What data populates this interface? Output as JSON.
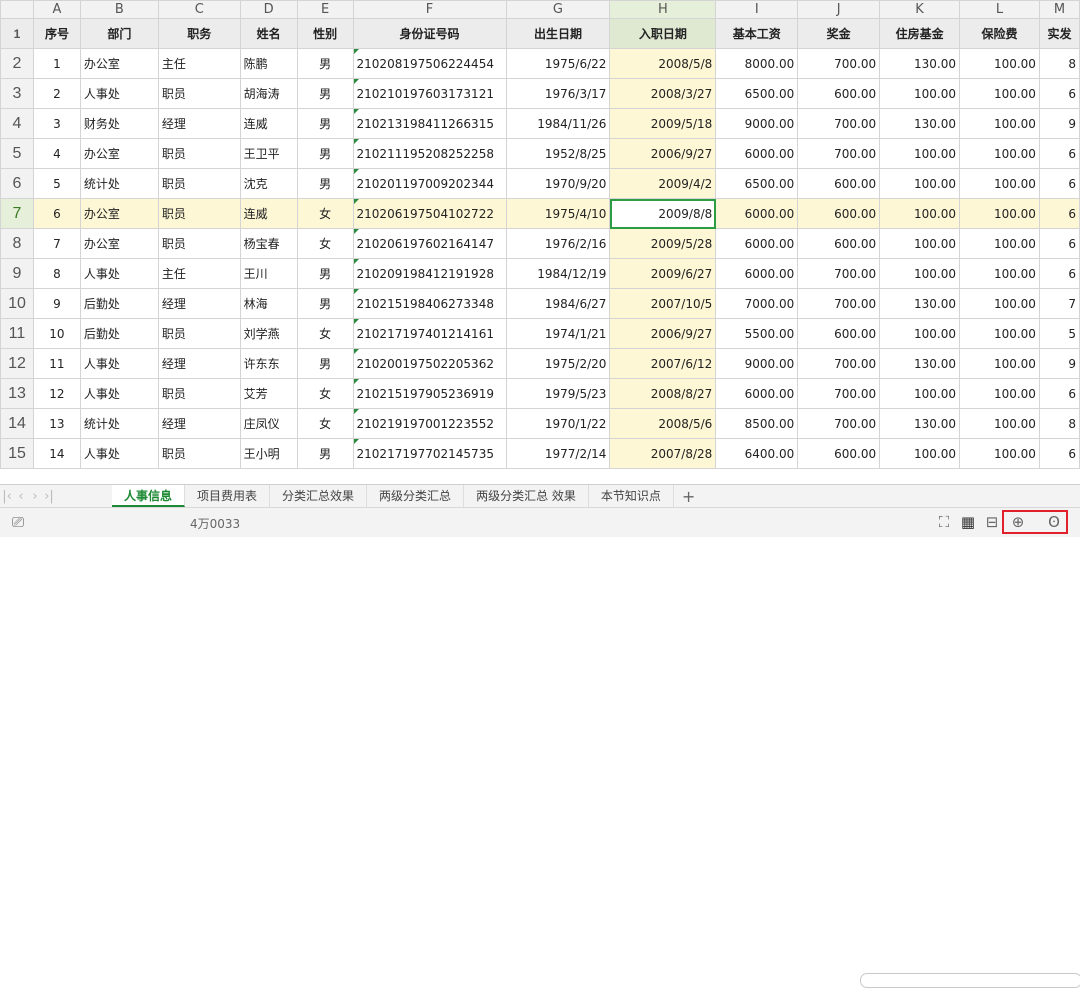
{
  "columns": [
    "A",
    "B",
    "C",
    "D",
    "E",
    "F",
    "G",
    "H",
    "I",
    "J",
    "K",
    "L",
    "M"
  ],
  "header_row": [
    "序号",
    "部门",
    "职务",
    "姓名",
    "性别",
    "身份证号码",
    "出生日期",
    "入职日期",
    "基本工资",
    "奖金",
    "住房基金",
    "保险费",
    "实发"
  ],
  "rows": [
    [
      "1",
      "办公室",
      "主任",
      "陈鹏",
      "男",
      "210208197506224454",
      "1975/6/22",
      "2008/5/8",
      "8000.00",
      "700.00",
      "130.00",
      "100.00",
      "8"
    ],
    [
      "2",
      "人事处",
      "职员",
      "胡海涛",
      "男",
      "210210197603173121",
      "1976/3/17",
      "2008/3/27",
      "6500.00",
      "600.00",
      "100.00",
      "100.00",
      "6"
    ],
    [
      "3",
      "财务处",
      "经理",
      "连威",
      "男",
      "210213198411266315",
      "1984/11/26",
      "2009/5/18",
      "9000.00",
      "700.00",
      "130.00",
      "100.00",
      "9"
    ],
    [
      "4",
      "办公室",
      "职员",
      "王卫平",
      "男",
      "210211195208252258",
      "1952/8/25",
      "2006/9/27",
      "6000.00",
      "700.00",
      "100.00",
      "100.00",
      "6"
    ],
    [
      "5",
      "统计处",
      "职员",
      "沈克",
      "男",
      "210201197009202344",
      "1970/9/20",
      "2009/4/2",
      "6500.00",
      "600.00",
      "100.00",
      "100.00",
      "6"
    ],
    [
      "6",
      "办公室",
      "职员",
      "连威",
      "女",
      "210206197504102722",
      "1975/4/10",
      "2009/8/8",
      "6000.00",
      "600.00",
      "100.00",
      "100.00",
      "6"
    ],
    [
      "7",
      "办公室",
      "职员",
      "杨宝春",
      "女",
      "210206197602164147",
      "1976/2/16",
      "2009/5/28",
      "6000.00",
      "600.00",
      "100.00",
      "100.00",
      "6"
    ],
    [
      "8",
      "人事处",
      "主任",
      "王川",
      "男",
      "210209198412191928",
      "1984/12/19",
      "2009/6/27",
      "6000.00",
      "700.00",
      "100.00",
      "100.00",
      "6"
    ],
    [
      "9",
      "后勤处",
      "经理",
      "林海",
      "男",
      "210215198406273348",
      "1984/6/27",
      "2007/10/5",
      "7000.00",
      "700.00",
      "130.00",
      "100.00",
      "7"
    ],
    [
      "10",
      "后勤处",
      "职员",
      "刘学燕",
      "女",
      "210217197401214161",
      "1974/1/21",
      "2006/9/27",
      "5500.00",
      "600.00",
      "100.00",
      "100.00",
      "5"
    ],
    [
      "11",
      "人事处",
      "经理",
      "许东东",
      "男",
      "210200197502205362",
      "1975/2/20",
      "2007/6/12",
      "9000.00",
      "700.00",
      "130.00",
      "100.00",
      "9"
    ],
    [
      "12",
      "人事处",
      "职员",
      "艾芳",
      "女",
      "210215197905236919",
      "1979/5/23",
      "2008/8/27",
      "6000.00",
      "700.00",
      "100.00",
      "100.00",
      "6"
    ],
    [
      "13",
      "统计处",
      "经理",
      "庄凤仪",
      "女",
      "210219197001223552",
      "1970/1/22",
      "2008/5/6",
      "8500.00",
      "700.00",
      "130.00",
      "100.00",
      "8"
    ],
    [
      "14",
      "人事处",
      "职员",
      "王小明",
      "男",
      "210217197702145735",
      "1977/2/14",
      "2007/8/28",
      "6400.00",
      "600.00",
      "100.00",
      "100.00",
      "6"
    ]
  ],
  "sheet_tabs": [
    "人事信息",
    "项目费用表",
    "分类汇总效果",
    "两级分类汇总",
    "两级分类汇总 效果",
    "本节知识点"
  ],
  "add_tab_label": "+",
  "status": {
    "cell_info": "4万0033"
  },
  "colors": {
    "accent": "#1f8a34",
    "highlight_box": "#e0212b"
  }
}
